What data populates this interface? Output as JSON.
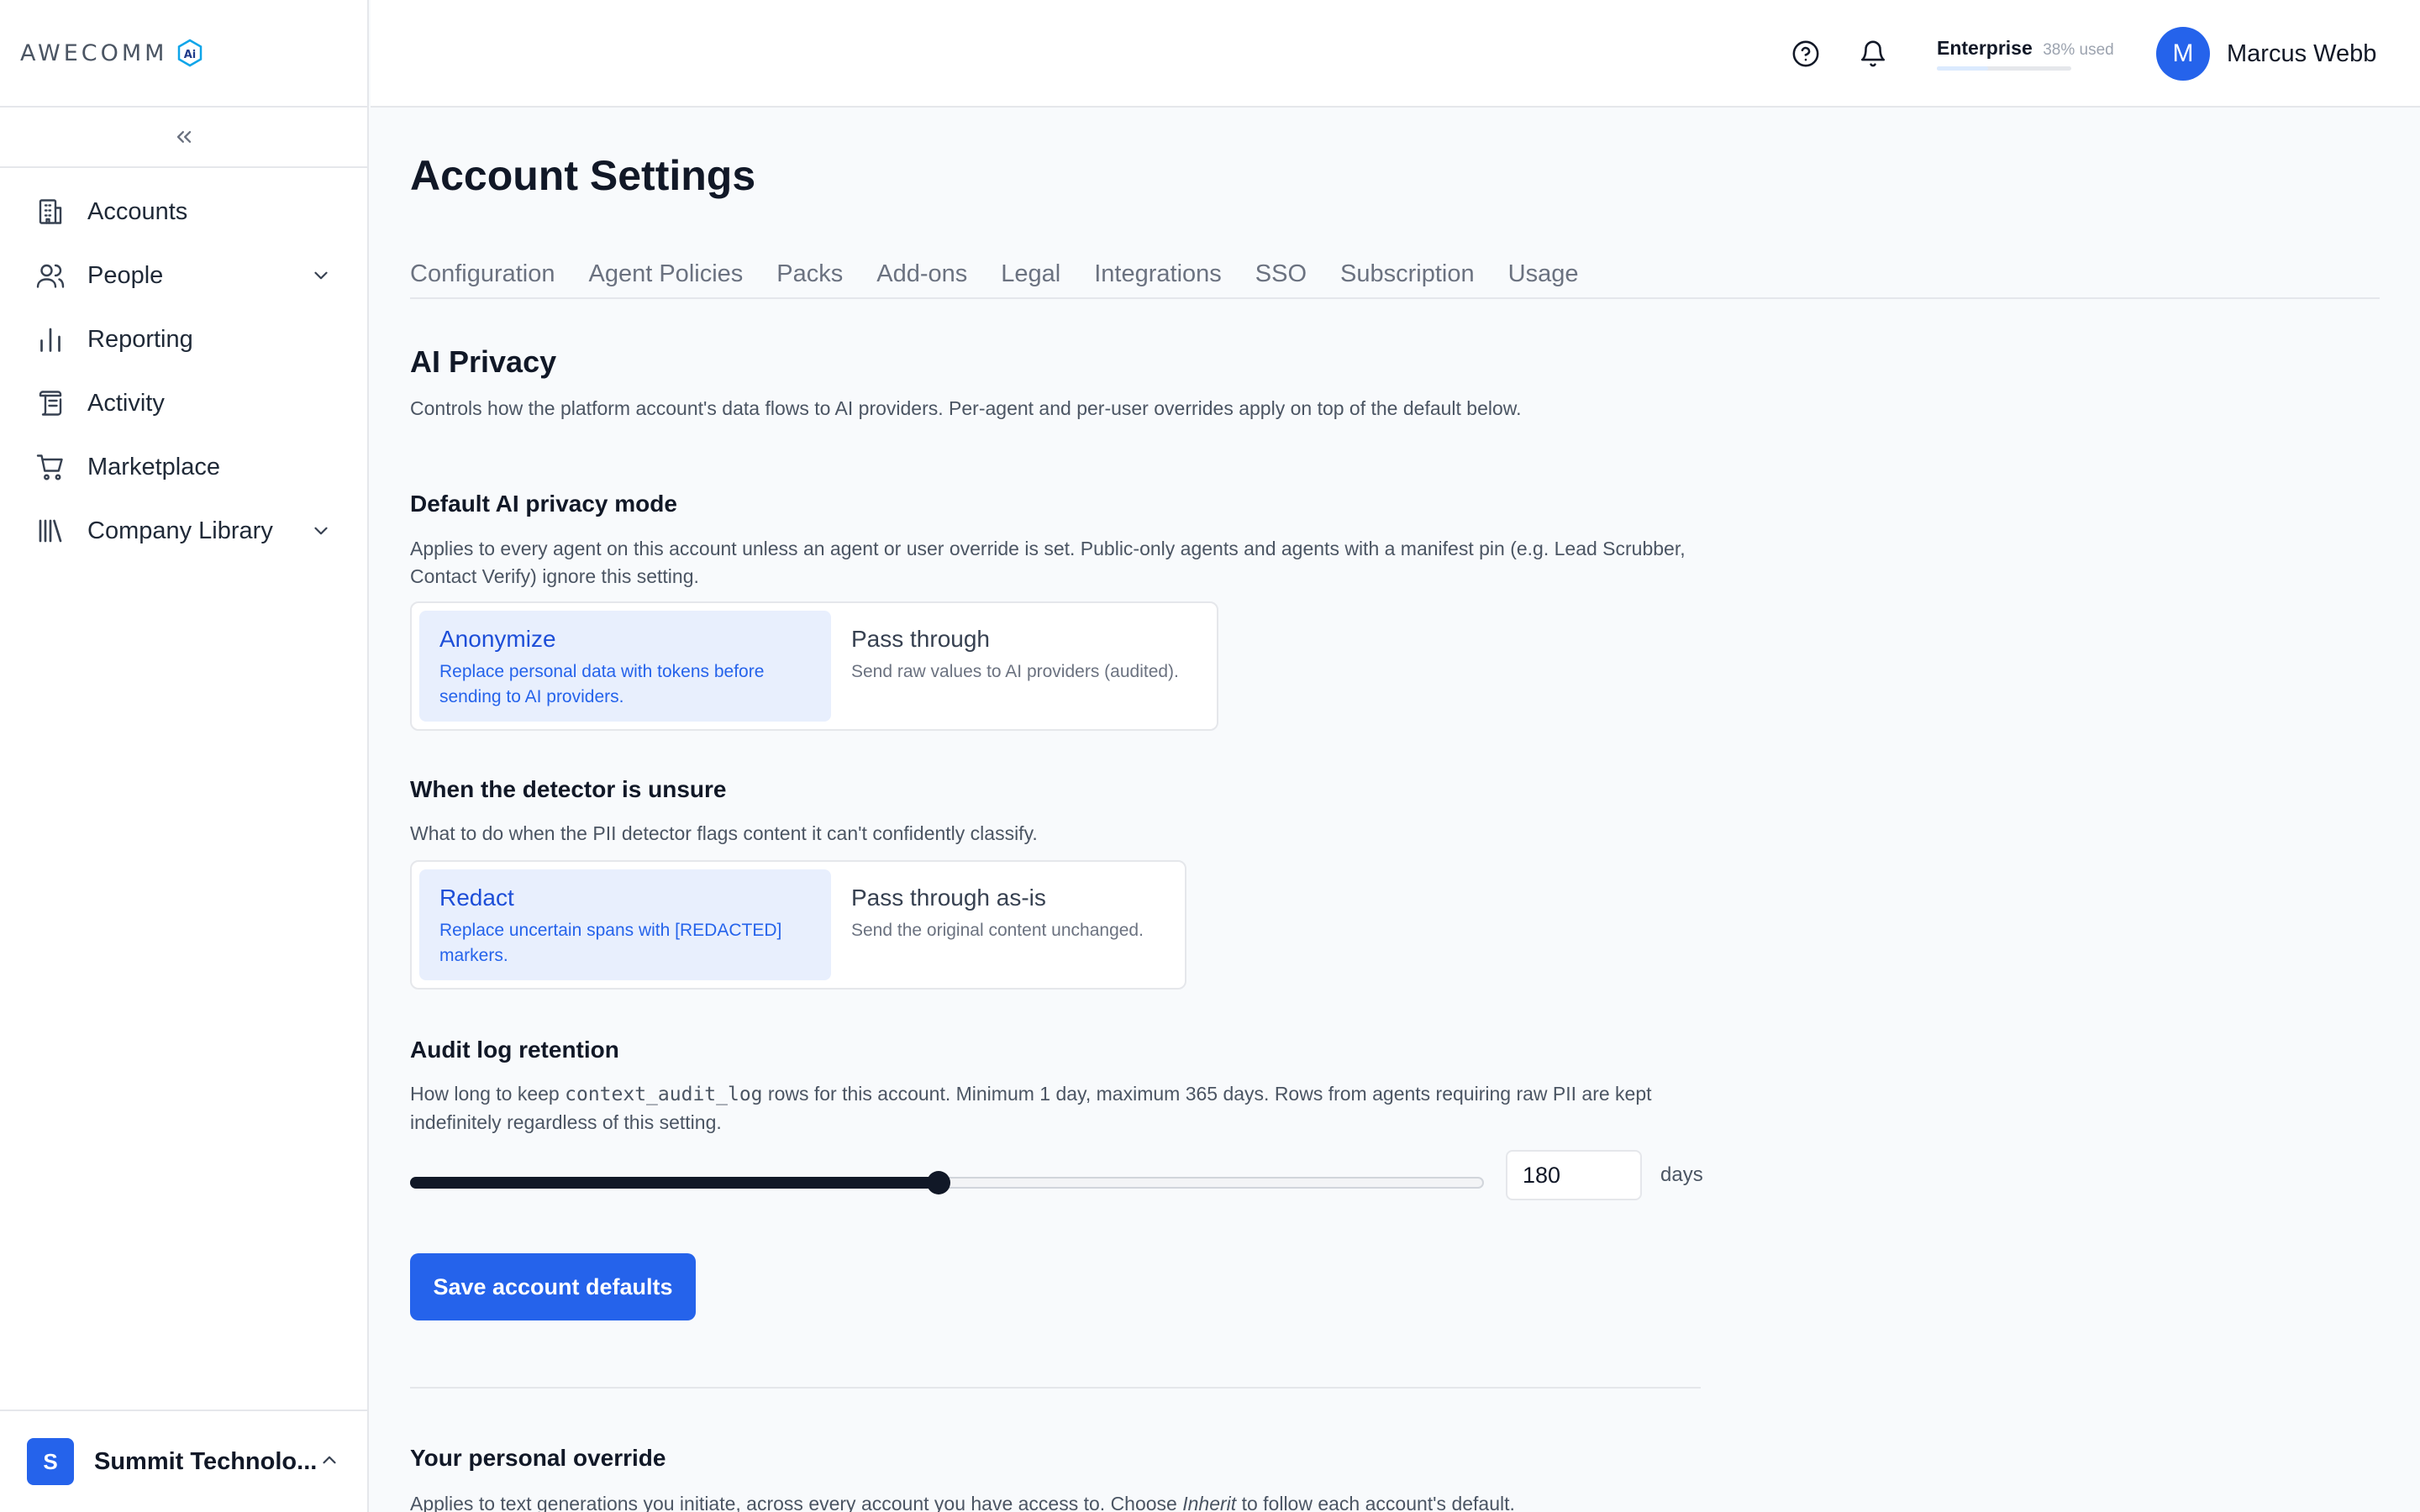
{
  "brand": {
    "logo_text": "AWECOMM",
    "logo_badge": "Ai",
    "accent": "#2563eb"
  },
  "sidebar": {
    "items": [
      {
        "label": "Accounts",
        "icon": "building-icon",
        "expandable": false
      },
      {
        "label": "People",
        "icon": "users-icon",
        "expandable": true
      },
      {
        "label": "Reporting",
        "icon": "bar-chart-icon",
        "expandable": false
      },
      {
        "label": "Activity",
        "icon": "scroll-icon",
        "expandable": false
      },
      {
        "label": "Marketplace",
        "icon": "cart-icon",
        "expandable": false
      },
      {
        "label": "Company Library",
        "icon": "library-icon",
        "expandable": true
      }
    ],
    "org": {
      "initial": "S",
      "name": "Summit Technolo..."
    }
  },
  "header": {
    "plan": {
      "name": "Enterprise",
      "used_label": "38% used",
      "used_fraction": 0.38
    },
    "user": {
      "initial": "M",
      "name": "Marcus Webb"
    }
  },
  "page": {
    "title": "Account Settings",
    "tabs": [
      "Configuration",
      "Agent Policies",
      "Packs",
      "Add-ons",
      "Legal",
      "Integrations",
      "SSO",
      "Subscription",
      "Usage"
    ]
  },
  "ai_privacy": {
    "title": "AI Privacy",
    "description": "Controls how the platform account's data flows to AI providers. Per-agent and per-user overrides apply on top of the default below.",
    "default_mode": {
      "title": "Default AI privacy mode",
      "description": "Applies to every agent on this account unless an agent or user override is set. Public-only agents and agents with a manifest pin (e.g. Lead Scrubber, Contact Verify) ignore this setting.",
      "options": [
        {
          "title": "Anonymize",
          "subtitle": "Replace personal data with tokens before sending to AI providers.",
          "selected": true
        },
        {
          "title": "Pass through",
          "subtitle": "Send raw values to AI providers (audited).",
          "selected": false
        }
      ]
    },
    "detector": {
      "title": "When the detector is unsure",
      "description": "What to do when the PII detector flags content it can't confidently classify.",
      "options": [
        {
          "title": "Redact",
          "subtitle": "Replace uncertain spans with [REDACTED] markers.",
          "selected": true
        },
        {
          "title": "Pass through as-is",
          "subtitle": "Send the original content unchanged.",
          "selected": false
        }
      ]
    },
    "retention": {
      "title": "Audit log retention",
      "desc_pre": "How long to keep ",
      "desc_code": "context_audit_log",
      "desc_post": " rows for this account. Minimum 1 day, maximum 365 days. Rows from agents requiring raw PII are kept indefinitely regardless of this setting.",
      "value": "180",
      "min": 1,
      "max": 365,
      "unit": "days"
    },
    "save_label": "Save account defaults"
  },
  "personal_override": {
    "title": "Your personal override",
    "desc_pre": "Applies to text generations you initiate, across every account you have access to. Choose ",
    "desc_em": "Inherit",
    "desc_post": " to follow each account's default."
  }
}
